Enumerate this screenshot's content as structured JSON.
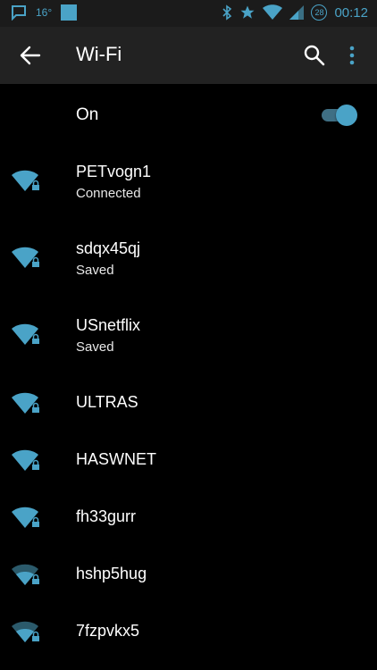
{
  "status_bar": {
    "temperature": "16°",
    "battery_level": "28",
    "time": "00:12",
    "icons": [
      "chat-icon",
      "app-square-icon",
      "bluetooth-icon",
      "star-icon",
      "wifi-signal-icon",
      "cell-signal-icon",
      "battery-icon"
    ]
  },
  "app_bar": {
    "title": "Wi-Fi",
    "icons": [
      "back-arrow-icon",
      "search-icon",
      "overflow-menu-icon"
    ]
  },
  "toggle": {
    "label": "On",
    "enabled": true
  },
  "colors": {
    "accent": "#4aa3c7",
    "background": "#000000",
    "app_bar": "#222222",
    "status_bar": "#1b1b1b",
    "weak_signal": "#2b5a6b"
  },
  "networks": [
    {
      "ssid": "PETvogn1",
      "status": "Connected",
      "signal": 4,
      "secured": true
    },
    {
      "ssid": "sdqx45qj",
      "status": "Saved",
      "signal": 4,
      "secured": true
    },
    {
      "ssid": "USnetflix",
      "status": "Saved",
      "signal": 4,
      "secured": true
    },
    {
      "ssid": "ULTRAS",
      "status": "",
      "signal": 4,
      "secured": true
    },
    {
      "ssid": "HASWNET",
      "status": "",
      "signal": 4,
      "secured": true
    },
    {
      "ssid": "fh33gurr",
      "status": "",
      "signal": 4,
      "secured": true
    },
    {
      "ssid": "hshp5hug",
      "status": "",
      "signal": 2,
      "secured": true
    },
    {
      "ssid": "7fzpvkx5",
      "status": "",
      "signal": 2,
      "secured": true
    }
  ]
}
